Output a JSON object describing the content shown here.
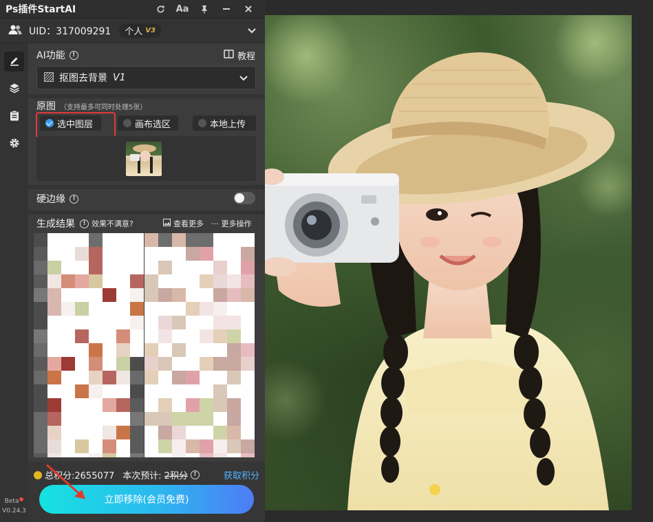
{
  "titlebar": {
    "title": "Ps插件StartAI",
    "font_icon_label": "Aa"
  },
  "user": {
    "uid_label": "UID：317009291",
    "tier_label": "个人",
    "tier_badge": "V3"
  },
  "sidebar": {
    "items": [
      "edit-icon",
      "layers-icon",
      "clipboard-icon",
      "gear-icon"
    ],
    "beta_label": "Beta",
    "version": "V0.24.3"
  },
  "ai_section": {
    "label": "AI功能",
    "tutorial_label": "教程",
    "feature_label": "抠图去背景",
    "feature_version": "V1"
  },
  "source": {
    "label": "原图",
    "note": "（支持最多可同时处理5张）",
    "options": [
      {
        "label": "选中图层",
        "selected": true
      },
      {
        "label": "画布选区",
        "selected": false
      },
      {
        "label": "本地上传",
        "selected": false
      }
    ]
  },
  "hard_edge": {
    "label": "硬边缘",
    "enabled": false
  },
  "results": {
    "label": "生成结果",
    "feedback_label": "效果不满意?",
    "view_more_label": "查看更多",
    "more_actions_label": "更多操作"
  },
  "footer": {
    "total_points_label": "总积分:2655077",
    "estimate_prefix": "本次预计:",
    "estimate_value": "2积分",
    "get_points_label": "获取积分",
    "main_button_label": "立即移除(会员免费)"
  },
  "colors": {
    "accent_blue": "#3a9bec",
    "highlight_red": "#e23a3a",
    "link_blue": "#56b4ff",
    "coin_gold": "#e3b826",
    "button_gradient_start": "#16e2e0",
    "button_gradient_end": "#4d7cf6"
  }
}
